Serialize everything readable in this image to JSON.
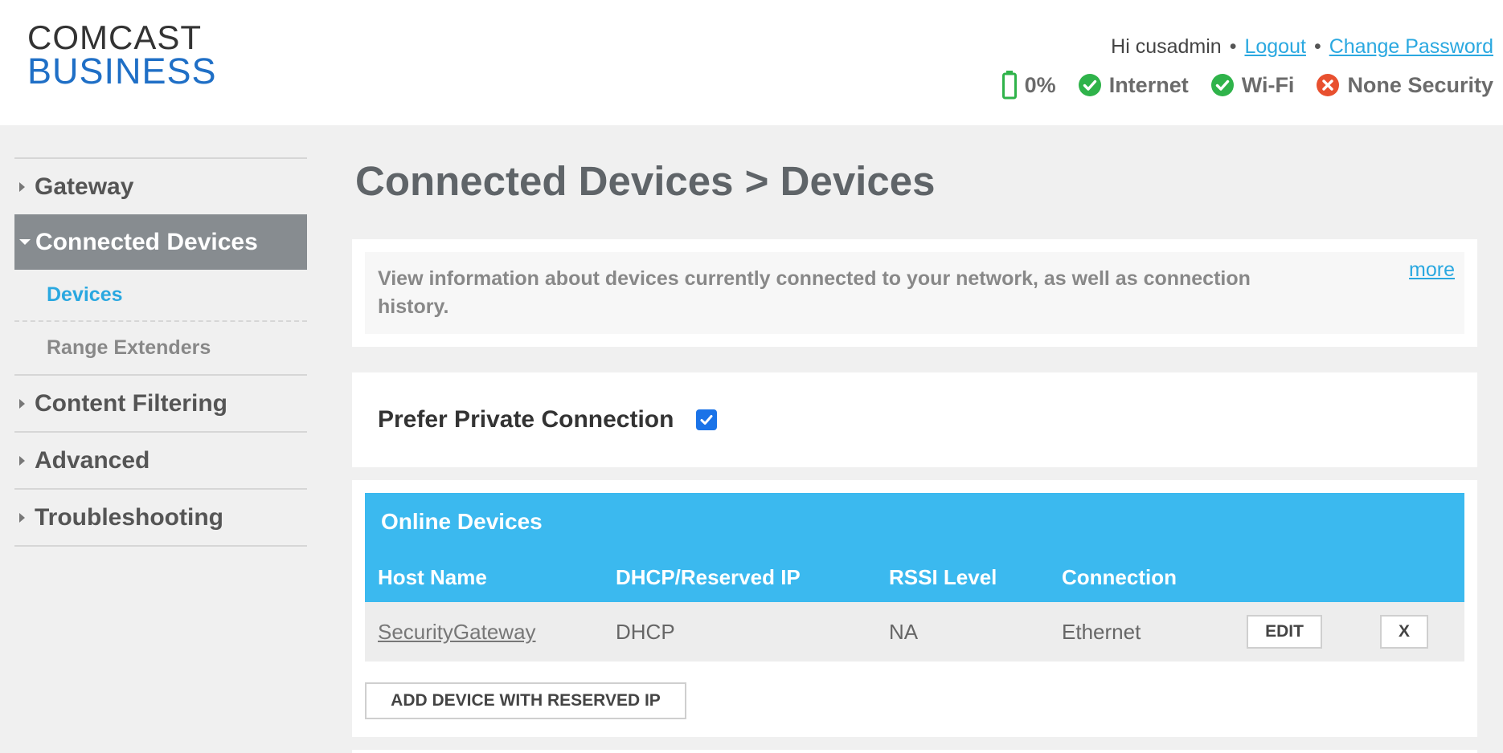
{
  "header": {
    "logo_line1": "COMCAST",
    "logo_line2": "BUSINESS",
    "greeting": "Hi cusadmin",
    "separator": "•",
    "logout_label": "Logout",
    "change_password_label": "Change Password",
    "status": {
      "battery": {
        "label": "0%",
        "icon": "battery-icon"
      },
      "internet": {
        "label": "Internet",
        "icon": "check-circle-icon",
        "color": "#2fb34a"
      },
      "wifi": {
        "label": "Wi-Fi",
        "icon": "check-circle-icon",
        "color": "#2fb34a"
      },
      "security": {
        "label": "None Security",
        "icon": "error-circle-icon",
        "color": "#e8502f"
      }
    }
  },
  "sidebar": {
    "items": [
      {
        "label": "Gateway"
      },
      {
        "label": "Connected Devices"
      },
      {
        "label": "Content Filtering"
      },
      {
        "label": "Advanced"
      },
      {
        "label": "Troubleshooting"
      }
    ],
    "sub_items": [
      {
        "label": "Devices"
      },
      {
        "label": "Range Extenders"
      }
    ]
  },
  "main": {
    "title": "Connected Devices > Devices",
    "info_text": "View information about devices currently connected to your network, as well as connection history.",
    "more_label": "more",
    "prefer_private_label": "Prefer Private Connection",
    "prefer_private_checked": true,
    "online_devices": {
      "title": "Online Devices",
      "columns": [
        "Host Name",
        "DHCP/Reserved IP",
        "RSSI Level",
        "Connection"
      ],
      "rows": [
        {
          "host": "SecurityGateway",
          "ip_type": "DHCP",
          "rssi": "NA",
          "connection": "Ethernet",
          "edit_label": "EDIT",
          "delete_label": "X"
        }
      ],
      "add_button_label": "ADD DEVICE WITH RESERVED IP"
    }
  },
  "colors": {
    "accent": "#2aa8e0",
    "table_header": "#3bb9ef",
    "active_nav": "#878c90"
  }
}
